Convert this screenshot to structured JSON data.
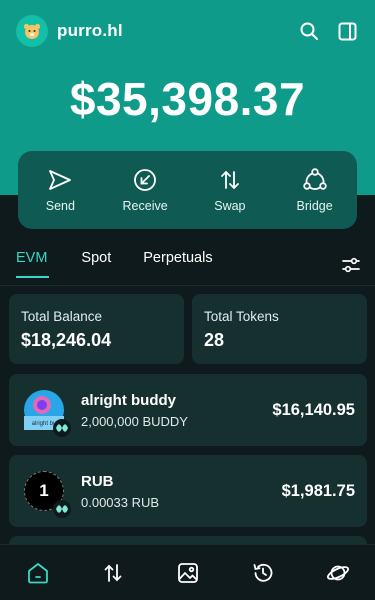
{
  "header": {
    "account_name": "purro.hl",
    "avatar_icon": "hamster-avatar-icon"
  },
  "balance": "$35,398.37",
  "actions": [
    {
      "label": "Send",
      "icon": "send-icon"
    },
    {
      "label": "Receive",
      "icon": "receive-icon"
    },
    {
      "label": "Swap",
      "icon": "swap-icon"
    },
    {
      "label": "Bridge",
      "icon": "bridge-icon"
    }
  ],
  "tabs": [
    {
      "label": "EVM",
      "active": true
    },
    {
      "label": "Spot",
      "active": false
    },
    {
      "label": "Perpetuals",
      "active": false
    }
  ],
  "stats": {
    "total_balance_title": "Total Balance",
    "total_balance_value": "$18,246.04",
    "total_tokens_title": "Total Tokens",
    "total_tokens_value": "28"
  },
  "tokens": [
    {
      "name": "alright buddy",
      "amount": "2,000,000 BUDDY",
      "value": "$16,140.95",
      "logo_text": "alright bu"
    },
    {
      "name": "RUB",
      "amount": "0.00033 RUB",
      "value": "$1,981.75",
      "logo_text": "1"
    }
  ],
  "bottom_nav": [
    "home-icon",
    "transfer-icon",
    "gallery-icon",
    "history-icon",
    "explore-icon"
  ],
  "colors": {
    "accent": "#39d8c2",
    "hero": "#0e9b8a",
    "background": "#0f1a1c",
    "card": "#15302f"
  }
}
